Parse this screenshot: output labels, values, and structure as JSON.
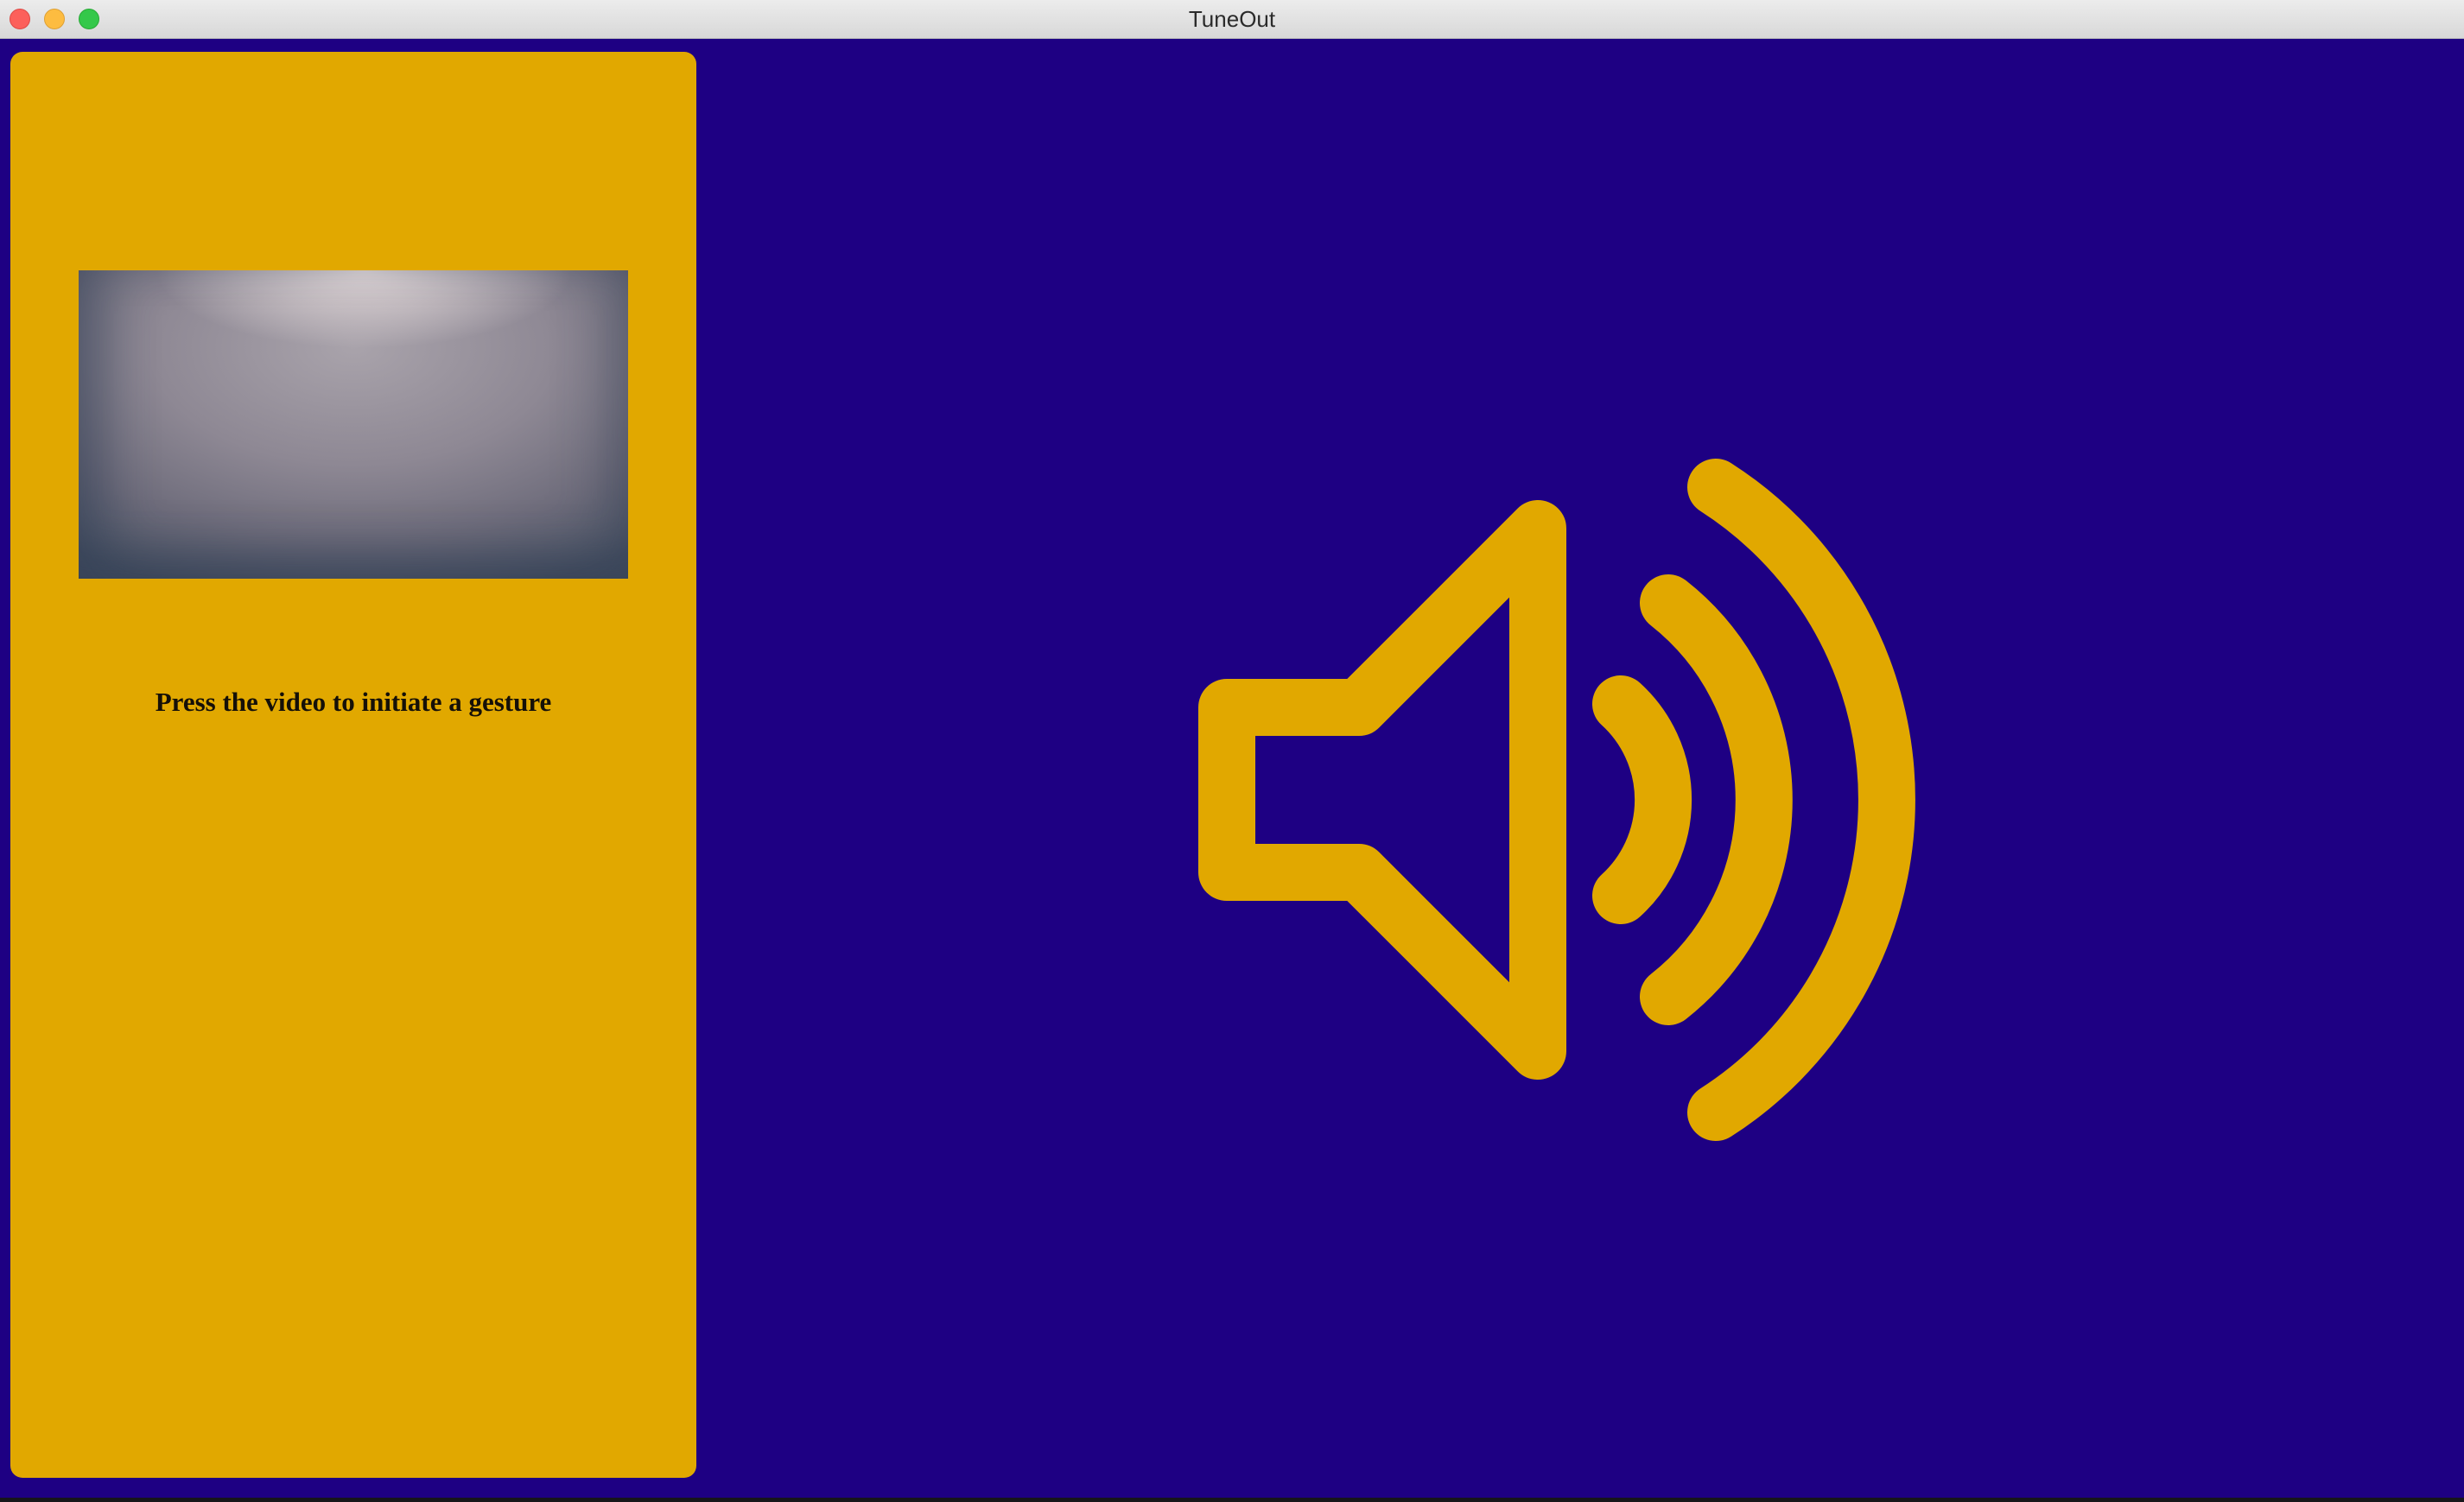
{
  "window": {
    "title": "TuneOut"
  },
  "panel": {
    "hint": "Press the video to initiate a gesture"
  },
  "icons": {
    "main": "speaker-volume-icon"
  },
  "colors": {
    "background": "#1e0083",
    "panel": "#e1a800",
    "icon": "#e1a800"
  }
}
